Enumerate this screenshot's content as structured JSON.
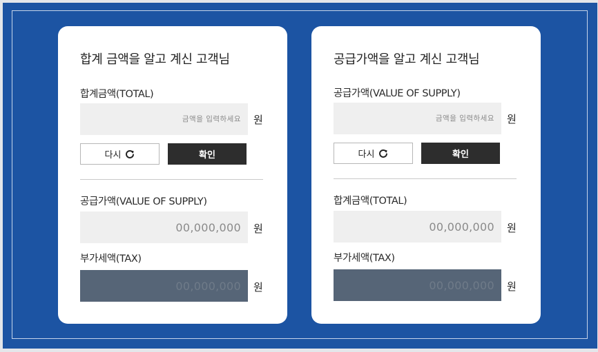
{
  "unit": "원",
  "cards": [
    {
      "title": "합계 금액을 알고 계신 고객님",
      "input_label": "합계금액(TOTAL)",
      "input_placeholder": "금액을 입력하세요",
      "input_value": "",
      "reset_label": "다시",
      "confirm_label": "확인",
      "result1_label": "공급가액(VALUE OF SUPPLY)",
      "result1_value": "00,000,000",
      "result2_label": "부가세액(TAX)",
      "result2_value": "00,000,000"
    },
    {
      "title": "공급가액을 알고 계신 고객님",
      "input_label": "공급가액(VALUE OF SUPPLY)",
      "input_placeholder": "금액을 입력하세요",
      "input_value": "",
      "reset_label": "다시",
      "confirm_label": "확인",
      "result1_label": "합계금액(TOTAL)",
      "result1_value": "00,000,000",
      "result2_label": "부가세액(TAX)",
      "result2_value": "00,000,000"
    }
  ],
  "icons": {
    "refresh": "refresh-icon"
  },
  "colors": {
    "background": "#1c54a3",
    "confirm_button": "#2d2d2d",
    "tax_field": "#566577"
  }
}
